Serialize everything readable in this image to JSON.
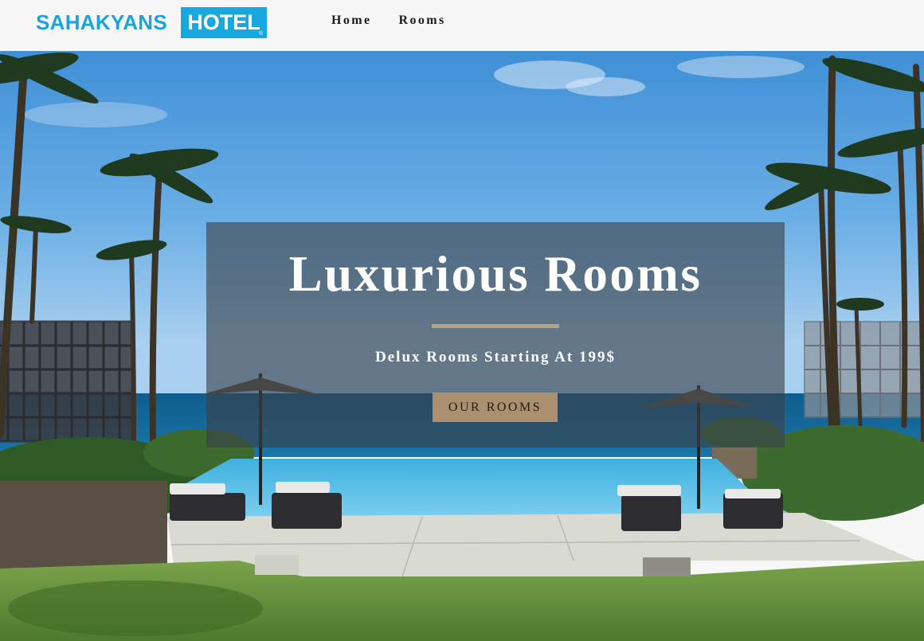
{
  "header": {
    "logo_main": "SAHAKYANS",
    "logo_box": "HOTEL",
    "logo_reg": "®",
    "nav": [
      {
        "label": "Home"
      },
      {
        "label": "Rooms"
      }
    ]
  },
  "hero": {
    "title": "Luxurious Rooms",
    "subtitle": "Delux Rooms Starting At 199$",
    "button_label": "OUR ROOMS",
    "background_image": "resort infinity pool overlooking the ocean, palm trees, sun loungers and umbrellas, lawn in foreground",
    "colors": {
      "accent_rule": "#b9a283",
      "button_bg": "#ab9070",
      "logo_blue": "#17a8e0",
      "panel_overlay": "rgba(58,64,72,0.62)"
    }
  }
}
